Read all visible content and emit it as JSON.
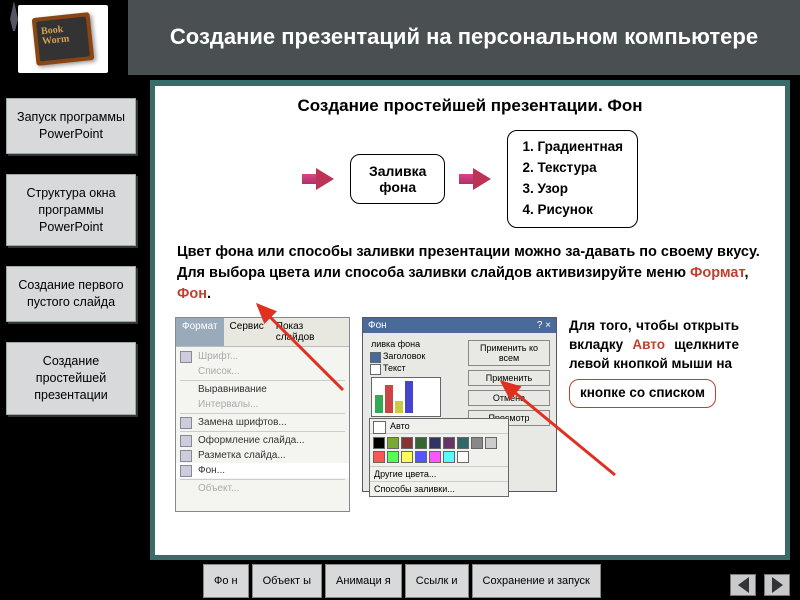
{
  "title": "Создание презентаций на персональном компьютере",
  "logo": {
    "label": "Book\nWorm"
  },
  "sidebar": {
    "items": [
      {
        "label": "Запуск программы PowerPoint"
      },
      {
        "label": "Структура окна программы PowerPoint"
      },
      {
        "label": "Создание первого пустого слайда"
      },
      {
        "label": "Создание простейшей презентации"
      }
    ]
  },
  "content": {
    "subtitle": "Создание простейшей презентации. Фон",
    "box1": "Заливка фона",
    "list": [
      "1. Градиентная",
      "2. Текстура",
      "3. Узор",
      "4. Рисунок"
    ],
    "para1_a": "Цвет фона или способы заливки презентации можно за-давать по своему вкусу. Для выбора цвета или способа заливки слайдов активизируйте меню ",
    "para1_b": "Формат",
    "para1_c": ", ",
    "para1_d": "Фон",
    "para1_e": ".",
    "side_a": "Для того, чтобы открыть вкладку ",
    "side_b": "Авто",
    "side_c": " щелкните левой кнопкой мыши на",
    "callout": "кнопке со списком"
  },
  "menu_shot": {
    "bar": [
      "Формат",
      "Сервис",
      "Показ слайдов"
    ],
    "items": [
      {
        "label": "Шрифт...",
        "dim": true
      },
      {
        "label": "Список...",
        "dim": true
      },
      {
        "label": "Выравнивание",
        "dim": false
      },
      {
        "label": "Интервалы...",
        "dim": true
      },
      {
        "label": "Замена шрифтов...",
        "dim": false
      },
      {
        "label": "Оформление слайда...",
        "dim": false
      },
      {
        "label": "Разметка слайда...",
        "dim": false
      },
      {
        "label": "Фон...",
        "dim": false,
        "sel": true
      },
      {
        "label": "Объект...",
        "dim": true
      }
    ]
  },
  "dialog_shot": {
    "title": "Фон",
    "section": "ливка фона",
    "rows": [
      "Заголовок",
      "Текст"
    ],
    "buttons": [
      "Применить ко всем",
      "Применить",
      "Отмена",
      "Просмотр"
    ],
    "dropdown": {
      "auto": "Авто",
      "more": "Другие цвета...",
      "fill": "Способы заливки..."
    }
  },
  "tabs": [
    "Фо н",
    "Объект ы",
    "Анимаци я",
    "Ссылк и",
    "Сохранение и запуск"
  ],
  "colors": {
    "swatches": [
      "#000",
      "#7a3",
      "#833",
      "#363",
      "#336",
      "#636",
      "#366",
      "#888",
      "#ccc",
      "#f55",
      "#5f5",
      "#ff5",
      "#55f",
      "#f5f",
      "#5ff",
      "#fff"
    ]
  }
}
